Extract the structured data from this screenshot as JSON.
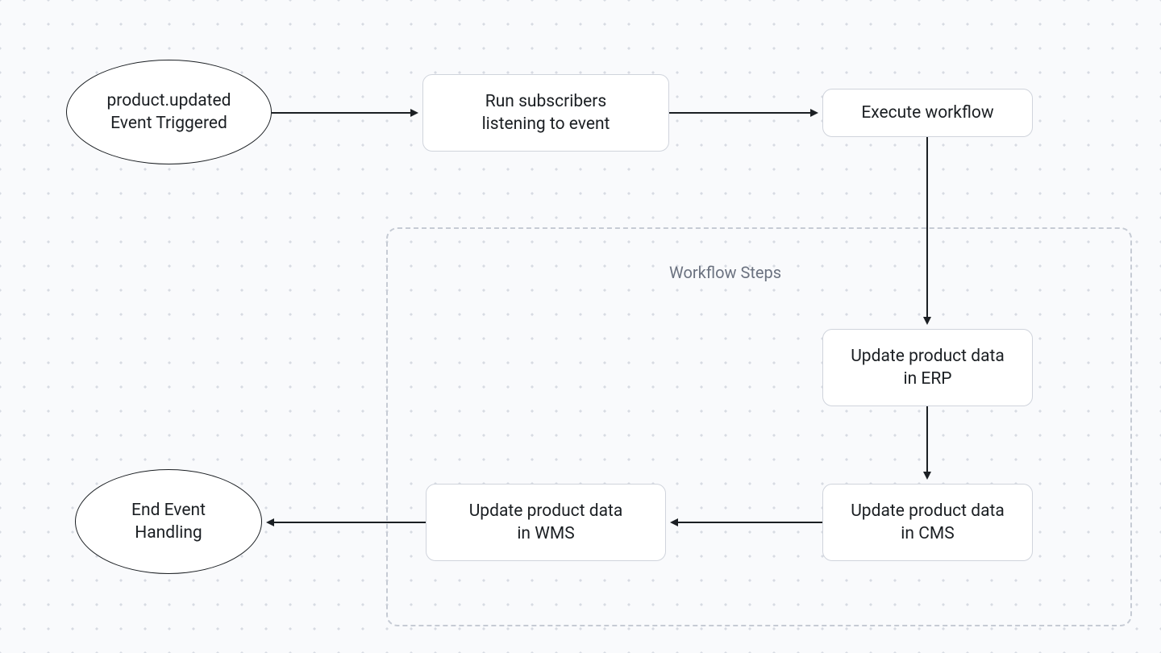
{
  "nodes": {
    "start": {
      "line1": "product.updated",
      "line2": "Event Triggered"
    },
    "subscribers": {
      "line1": "Run subscribers",
      "line2": "listening to event"
    },
    "execute": {
      "line1": "Execute workflow"
    },
    "erp": {
      "line1": "Update product data",
      "line2": "in ERP"
    },
    "cms": {
      "line1": "Update product data",
      "line2": "in CMS"
    },
    "wms": {
      "line1": "Update product data",
      "line2": "in WMS"
    },
    "end": {
      "line1": "End Event",
      "line2": "Handling"
    }
  },
  "group": {
    "label": "Workflow Steps"
  },
  "chart_data": {
    "type": "flowchart",
    "nodes": [
      {
        "id": "start",
        "shape": "ellipse",
        "label": "product.updated Event Triggered"
      },
      {
        "id": "subscribers",
        "shape": "rect",
        "label": "Run subscribers listening to event"
      },
      {
        "id": "execute",
        "shape": "rect",
        "label": "Execute workflow"
      },
      {
        "id": "erp",
        "shape": "rect",
        "label": "Update product data in ERP",
        "group": "workflow_steps"
      },
      {
        "id": "cms",
        "shape": "rect",
        "label": "Update product data in CMS",
        "group": "workflow_steps"
      },
      {
        "id": "wms",
        "shape": "rect",
        "label": "Update product data in WMS",
        "group": "workflow_steps"
      },
      {
        "id": "end",
        "shape": "ellipse",
        "label": "End Event Handling"
      }
    ],
    "groups": [
      {
        "id": "workflow_steps",
        "label": "Workflow Steps",
        "members": [
          "erp",
          "cms",
          "wms"
        ]
      }
    ],
    "edges": [
      {
        "from": "start",
        "to": "subscribers"
      },
      {
        "from": "subscribers",
        "to": "execute"
      },
      {
        "from": "execute",
        "to": "erp"
      },
      {
        "from": "erp",
        "to": "cms"
      },
      {
        "from": "cms",
        "to": "wms"
      },
      {
        "from": "wms",
        "to": "end"
      }
    ]
  }
}
